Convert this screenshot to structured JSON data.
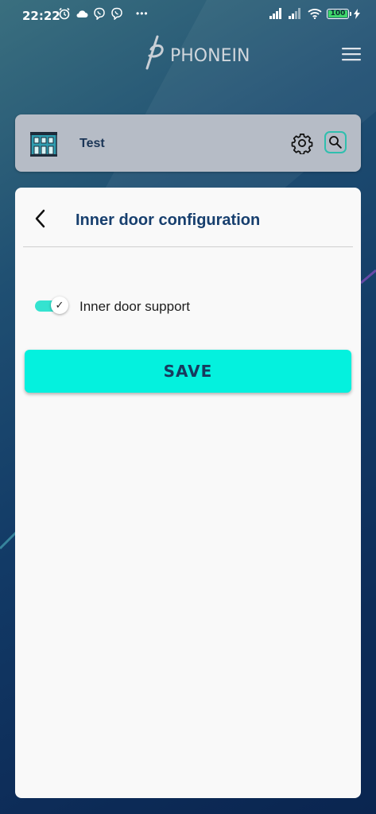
{
  "status_bar": {
    "time": "22:22",
    "more": "•••",
    "battery_level": "100",
    "icons_left": [
      "alarm-icon",
      "cloud-icon",
      "viber-icon",
      "viber-icon"
    ],
    "icons_right": [
      "signal-icon",
      "signal-icon",
      "wifi-icon",
      "battery-icon",
      "charging-icon"
    ]
  },
  "header": {
    "logo_text": "PHONEIN",
    "menu_icon": "hamburger-menu-icon"
  },
  "device": {
    "name": "Test",
    "icon": "building-icon",
    "settings_icon": "gear-icon",
    "search_icon": "search-icon"
  },
  "panel": {
    "back_icon": "chevron-left-icon",
    "title": "Inner door configuration",
    "toggle": {
      "label": "Inner door support",
      "checked": true,
      "knob_glyph": "✓"
    },
    "save_label": "SAVE"
  },
  "colors": {
    "accent": "#04f1de",
    "title": "#173f6e",
    "card_bg": "#b6bcc6",
    "panel_bg": "#f9f9f9"
  }
}
